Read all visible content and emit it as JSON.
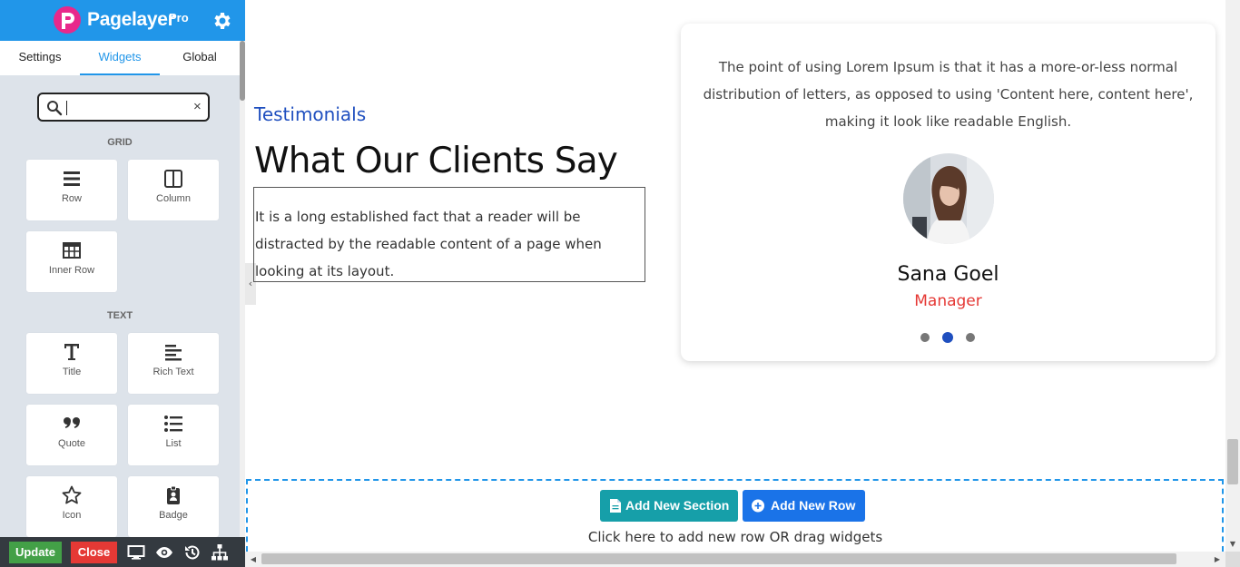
{
  "sidebar": {
    "logo": {
      "name": "Pagelayer",
      "badge": "Pro"
    },
    "tabs": [
      {
        "label": "Settings"
      },
      {
        "label": "Widgets",
        "active": true
      },
      {
        "label": "Global"
      }
    ],
    "search": {
      "value": "",
      "placeholder": "",
      "clear": "×"
    },
    "groups": [
      {
        "label": "GRID",
        "widgets": [
          {
            "label": "Row",
            "icon": "row-icon"
          },
          {
            "label": "Column",
            "icon": "column-icon"
          },
          {
            "label": "Inner Row",
            "icon": "inner-row-icon"
          }
        ]
      },
      {
        "label": "TEXT",
        "widgets": [
          {
            "label": "Title",
            "icon": "title-icon"
          },
          {
            "label": "Rich Text",
            "icon": "rich-text-icon"
          },
          {
            "label": "Quote",
            "icon": "quote-icon"
          },
          {
            "label": "List",
            "icon": "list-icon"
          },
          {
            "label": "Icon",
            "icon": "star-icon"
          },
          {
            "label": "Badge",
            "icon": "badge-icon"
          }
        ]
      }
    ],
    "footer": {
      "update": "Update",
      "close": "Close",
      "icons": [
        "desktop-icon",
        "eye-icon",
        "history-icon",
        "sitemap-icon"
      ]
    }
  },
  "canvas": {
    "testimonials_label": "Testimonials",
    "heading": "What Our Clients Say",
    "description": "It is a long established fact that a reader will be distracted by the readable content of a page when looking at its layout.",
    "testimonial": {
      "quote": "The point of using Lorem Ipsum is that it has a more-or-less normal distribution of letters, as opposed to using 'Content here, content here', making it look like readable English.",
      "name": "Sana Goel",
      "role": "Manager",
      "slides": 3,
      "active_slide": 2
    },
    "add_section": "Add New Section",
    "add_row": "Add New Row",
    "hint": "Click here to add new row OR drag widgets"
  },
  "colors": {
    "header_blue": "#2196e9",
    "accent_blue": "#1f4fbf",
    "role_red": "#e53935",
    "update_green": "#43a047",
    "close_red": "#e53935",
    "section_teal": "#169fa9",
    "row_blue": "#1a73e8"
  }
}
